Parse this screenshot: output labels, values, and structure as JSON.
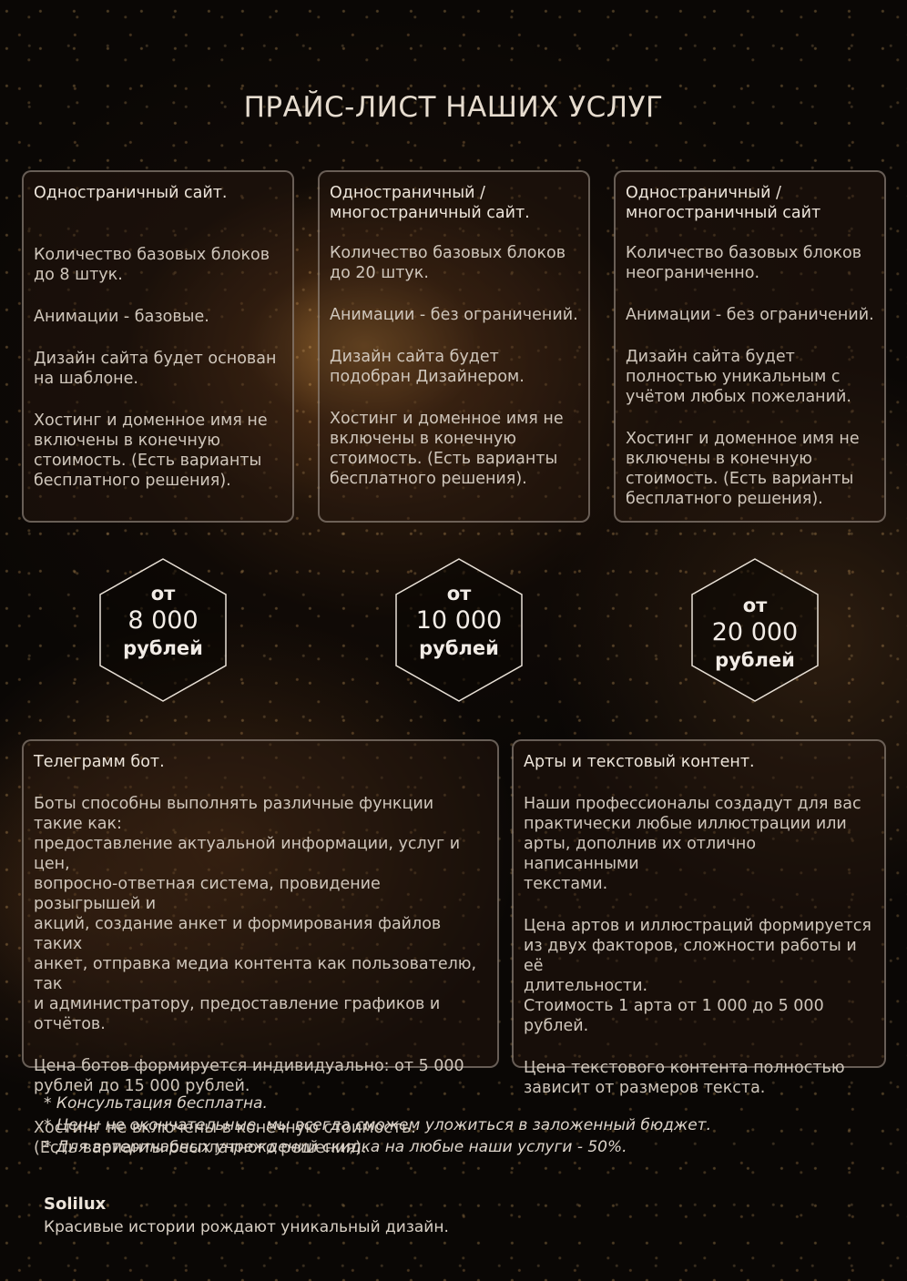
{
  "title": "ПРАЙС-ЛИСТ НАШИХ УСЛУГ",
  "cards": [
    {
      "title": "Одностраничный сайт.",
      "blocks": "Количество базовых блоков\nдо 8 штук.",
      "animations": "Анимации - базовые.",
      "design": "Дизайн сайта будет основан\nна шаблоне.",
      "hosting": "Хостинг и доменное имя не\nвключены в конечную\nстоимость. (Есть варианты\nбесплатного решения)."
    },
    {
      "title": "Одностраничный /\nмногостраничный сайт.",
      "blocks": "Количество базовых блоков\nдо 20 штук.",
      "animations": "Анимации - без ограничений.",
      "design": "Дизайн сайта будет\nподобран Дизайнером.",
      "hosting": "Хостинг и доменное имя не\nвключены в конечную\nстоимость. (Есть варианты\nбесплатного решения)."
    },
    {
      "title": "Одностраничный /\nмногостраничный сайт",
      "blocks": "Количество базовых блоков\nнеограниченно.",
      "animations": "Анимации - без ограничений.",
      "design": "Дизайн сайта будет\nполностью уникальным с\nучётом любых пожеланий.",
      "hosting": "Хостинг и доменное имя не\nвключены в конечную\nстоимость. (Есть варианты\nбесплатного решения)."
    }
  ],
  "prices": [
    {
      "from": "от",
      "amount": "8 000",
      "currency": "рублей"
    },
    {
      "from": "от",
      "amount": "10 000",
      "currency": "рублей"
    },
    {
      "from": "от",
      "amount": "20 000",
      "currency": "рублей"
    }
  ],
  "bot": {
    "title": "Телеграмм бот.",
    "description": "Боты способны выполнять различные функции такие как:\nпредоставление актуальной информации, услуг и цен,\nвопросно-ответная система, провидение розыгрышей и\nакций, создание анкет и формирования файлов таких\nанкет, отправка медиа контента как пользователю, так\nи администратору, предоставление графиков и отчётов.",
    "price": "Цена ботов формируется индивидуально: от 5 000\nрублей до 15 000 рублей.",
    "hosting": "Хостинг не включены в конечную стоимость.\n(Есть варианты бесплатного решения)."
  },
  "arts": {
    "title": "Арты и текстовый контент.",
    "description": "Наши профессионалы создадут для вас\nпрактически любые иллюстрации или\nарты, дополнив их отлично написанными\nтекстами.",
    "price": "Цена артов и иллюстраций формируется\nиз двух факторов, сложности работы и её\nдлительности.\nСтоимость 1 арта от 1 000 до 5 000\nрублей.",
    "text_price": "Цена текстового контента полностью\nзависит от размеров текста."
  },
  "notes": [
    "* Консультация бесплатна.",
    "* Цены не окончательные, мы всегда сможем уложиться в заложенный бюджет.",
    "* Для ветеринарных учреждений скидка на любые наши услуги - 50%."
  ],
  "brand": "Solilux",
  "slogan": "Красивые истории рождают уникальный дизайн."
}
